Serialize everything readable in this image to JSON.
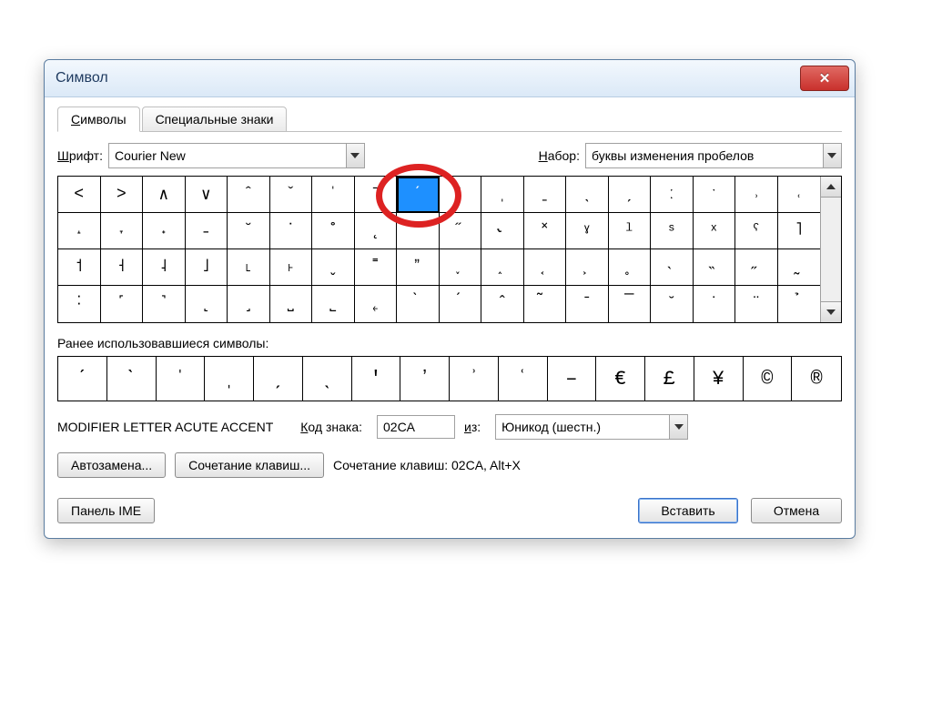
{
  "window": {
    "title": "Символ"
  },
  "tabs": {
    "symbols": "Символы",
    "special": "Специальные знаки"
  },
  "font": {
    "label_u": "Ш",
    "label_rest": "рифт:",
    "value": "Courier New"
  },
  "subset": {
    "label_u": "Н",
    "label_rest": "абор:",
    "value": "буквы изменения пробелов"
  },
  "grid": {
    "rows": [
      [
        "˂",
        "˃",
        "∧",
        "∨",
        "ˆ",
        "ˇ",
        "ˈ",
        "ˉ",
        "ˊ",
        "ˋ",
        "ˌ",
        "ˍ",
        "ˎ",
        "ˏ",
        "ː",
        "ˑ",
        "˒",
        "˓"
      ],
      [
        "˔",
        "˕",
        "˖",
        "˗",
        "˘",
        "˙",
        "˚",
        "˛",
        "˜",
        "˝",
        "˞",
        "˟",
        "ˠ",
        "ˡ",
        "ˢ",
        "ˣ",
        "ˤ",
        "˥"
      ],
      [
        "˦",
        "˧",
        "˨",
        "˩",
        "˪",
        "˫",
        "ˬ",
        "˭",
        "ˮ",
        "˯",
        "˰",
        "˱",
        "˲",
        "˳",
        "˴",
        "˵",
        "˶",
        "˷"
      ],
      [
        "˸",
        "˹",
        "˺",
        "˻",
        "˼",
        "˽",
        "˾",
        "˿",
        "̀",
        "́",
        "̂",
        "̃",
        "̄",
        "̅",
        "̆",
        "̇",
        "̈",
        "̉"
      ]
    ],
    "selected_row": 0,
    "selected_col": 8
  },
  "recent": {
    "label": "Ранее использовавшиеся символы:",
    "items": [
      "ˊ",
      "ˋ",
      "ˈ",
      "ˌ",
      "ˏ",
      "ˎ",
      "ʹ",
      "ʼ",
      "ʾ",
      "ʿ",
      "–",
      "€",
      "£",
      "¥",
      "©",
      "®"
    ]
  },
  "char_name": "MODIFIER LETTER ACUTE ACCENT",
  "code": {
    "label_u": "К",
    "label_rest": "од знака:",
    "value": "02CA"
  },
  "from": {
    "label_u": "и",
    "label_rest": "з:",
    "value": "Юникод (шестн.)"
  },
  "btns": {
    "autocorrect": "Автозамена...",
    "shortcut": "Сочетание клавиш...",
    "shortcut_text": "Сочетание клавиш: 02CA, Alt+X",
    "ime_u": "П",
    "ime_rest": "анель IME",
    "insert": "Вставить",
    "cancel": "Отмена"
  }
}
